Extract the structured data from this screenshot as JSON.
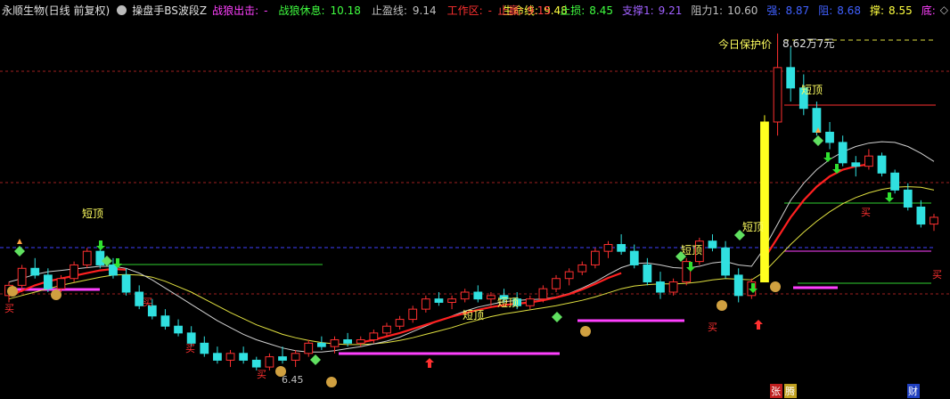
{
  "header": {
    "stock_name": "永顺生物(日线 前复权)",
    "indicator_name": "操盘手BS波段Z",
    "items": [
      {
        "label": "战狼出击:",
        "value": "-",
        "color": "#ff40ff"
      },
      {
        "label": "战狼休息:",
        "value": "10.18",
        "color": "#40ff40"
      },
      {
        "label": "止盈线:",
        "value": "9.14",
        "color": "#c0c0c0"
      },
      {
        "label": "工作区:",
        "value": "-",
        "color": "#ff3030"
      },
      {
        "label": "生命线:",
        "value": "9.48",
        "color": "#ffff40"
      }
    ],
    "right_items": [
      {
        "label": "止赢:",
        "value": "9.15",
        "color": "#ff4040"
      },
      {
        "label": "止损:",
        "value": "8.45",
        "color": "#40ff40"
      },
      {
        "label": "支撑1:",
        "value": "9.21",
        "color": "#a060ff"
      },
      {
        "label": "阻力1:",
        "value": "10.60",
        "color": "#c0c0c0"
      },
      {
        "label": "强:",
        "value": "8.87",
        "color": "#4060ff"
      },
      {
        "label": "阻:",
        "value": "8.68",
        "color": "#4060ff"
      },
      {
        "label": "撑:",
        "value": "8.55",
        "color": "#ffff40"
      },
      {
        "label": "底:",
        "value": "",
        "color": "#ff40ff"
      },
      {
        "label": "◇",
        "value": "",
        "color": "#c0c0c0"
      }
    ]
  },
  "annotations": {
    "protect_price_label": "今日保护价",
    "protect_price_value": "8.62万7元",
    "short_top": "短顶",
    "low_price": "6.45",
    "buy": "买",
    "zhang": "张",
    "teng": "腾",
    "cai": "财"
  },
  "colors": {
    "up": "#ff3030",
    "down": "#30e0e0",
    "ma_white": "#d0d0d0",
    "ma_red": "#ff2020",
    "ma_yellow": "#e0e040",
    "magenta": "#ff40ff"
  },
  "chart_data": {
    "type": "candlestick",
    "price_range": [
      6.2,
      11.5
    ],
    "candles": [
      [
        7.55,
        7.75,
        7.45,
        7.7
      ],
      [
        7.7,
        8.0,
        7.6,
        7.95
      ],
      [
        7.95,
        8.1,
        7.8,
        7.85
      ],
      [
        7.85,
        7.95,
        7.6,
        7.65
      ],
      [
        7.65,
        7.85,
        7.6,
        7.8
      ],
      [
        7.8,
        8.05,
        7.75,
        8.0
      ],
      [
        8.0,
        8.25,
        7.95,
        8.2
      ],
      [
        8.2,
        8.35,
        7.95,
        8.0
      ],
      [
        8.0,
        8.1,
        7.8,
        7.85
      ],
      [
        7.85,
        7.95,
        7.55,
        7.6
      ],
      [
        7.6,
        7.7,
        7.35,
        7.4
      ],
      [
        7.4,
        7.5,
        7.2,
        7.25
      ],
      [
        7.25,
        7.35,
        7.05,
        7.1
      ],
      [
        7.1,
        7.2,
        6.95,
        7.0
      ],
      [
        7.0,
        7.1,
        6.8,
        6.85
      ],
      [
        6.85,
        6.95,
        6.65,
        6.7
      ],
      [
        6.7,
        6.8,
        6.55,
        6.6
      ],
      [
        6.6,
        6.75,
        6.5,
        6.7
      ],
      [
        6.7,
        6.8,
        6.55,
        6.6
      ],
      [
        6.6,
        6.65,
        6.45,
        6.5
      ],
      [
        6.5,
        6.7,
        6.45,
        6.65
      ],
      [
        6.65,
        6.8,
        6.55,
        6.6
      ],
      [
        6.6,
        6.75,
        6.5,
        6.7
      ],
      [
        6.7,
        6.9,
        6.65,
        6.85
      ],
      [
        6.85,
        6.95,
        6.75,
        6.8
      ],
      [
        6.8,
        6.95,
        6.7,
        6.9
      ],
      [
        6.9,
        7.0,
        6.8,
        6.85
      ],
      [
        6.85,
        6.95,
        6.8,
        6.9
      ],
      [
        6.9,
        7.05,
        6.85,
        7.0
      ],
      [
        7.0,
        7.15,
        6.95,
        7.1
      ],
      [
        7.1,
        7.25,
        7.05,
        7.2
      ],
      [
        7.2,
        7.4,
        7.15,
        7.35
      ],
      [
        7.35,
        7.55,
        7.3,
        7.5
      ],
      [
        7.5,
        7.6,
        7.4,
        7.45
      ],
      [
        7.45,
        7.55,
        7.35,
        7.5
      ],
      [
        7.5,
        7.65,
        7.45,
        7.6
      ],
      [
        7.6,
        7.7,
        7.45,
        7.5
      ],
      [
        7.5,
        7.6,
        7.4,
        7.55
      ],
      [
        7.55,
        7.65,
        7.45,
        7.5
      ],
      [
        7.5,
        7.6,
        7.35,
        7.4
      ],
      [
        7.4,
        7.55,
        7.35,
        7.5
      ],
      [
        7.5,
        7.7,
        7.45,
        7.65
      ],
      [
        7.65,
        7.85,
        7.6,
        7.8
      ],
      [
        7.8,
        7.95,
        7.7,
        7.9
      ],
      [
        7.9,
        8.05,
        7.85,
        8.0
      ],
      [
        8.0,
        8.25,
        7.95,
        8.2
      ],
      [
        8.2,
        8.35,
        8.1,
        8.3
      ],
      [
        8.3,
        8.45,
        8.15,
        8.2
      ],
      [
        8.2,
        8.3,
        7.95,
        8.0
      ],
      [
        8.0,
        8.1,
        7.7,
        7.75
      ],
      [
        7.75,
        7.9,
        7.5,
        7.6
      ],
      [
        7.6,
        7.8,
        7.55,
        7.75
      ],
      [
        7.75,
        8.1,
        7.7,
        8.05
      ],
      [
        8.05,
        8.4,
        8.0,
        8.35
      ],
      [
        8.35,
        8.45,
        8.2,
        8.25
      ],
      [
        8.25,
        8.35,
        7.8,
        7.85
      ],
      [
        7.85,
        7.95,
        7.45,
        7.55
      ],
      [
        7.55,
        7.8,
        7.5,
        7.75
      ],
      [
        7.75,
        10.2,
        7.75,
        10.1
      ],
      [
        10.1,
        11.4,
        9.9,
        10.9
      ],
      [
        10.9,
        11.2,
        10.4,
        10.6
      ],
      [
        10.6,
        10.8,
        10.2,
        10.3
      ],
      [
        10.3,
        10.4,
        9.9,
        9.95
      ],
      [
        9.95,
        10.1,
        9.7,
        9.8
      ],
      [
        9.8,
        9.9,
        9.45,
        9.5
      ],
      [
        9.5,
        9.6,
        9.3,
        9.45
      ],
      [
        9.45,
        9.7,
        9.4,
        9.6
      ],
      [
        9.6,
        9.65,
        9.3,
        9.35
      ],
      [
        9.35,
        9.4,
        9.05,
        9.1
      ],
      [
        9.1,
        9.2,
        8.8,
        8.85
      ],
      [
        8.85,
        8.95,
        8.55,
        8.6
      ],
      [
        8.6,
        8.75,
        8.5,
        8.7
      ]
    ],
    "ma_white": [
      7.75,
      7.8,
      7.86,
      7.9,
      7.92,
      7.94,
      7.96,
      7.98,
      7.98,
      7.95,
      7.88,
      7.78,
      7.66,
      7.54,
      7.42,
      7.3,
      7.18,
      7.08,
      6.98,
      6.9,
      6.84,
      6.78,
      6.74,
      6.72,
      6.72,
      6.74,
      6.77,
      6.8,
      6.84,
      6.88,
      6.94,
      7.02,
      7.1,
      7.18,
      7.25,
      7.32,
      7.38,
      7.42,
      7.46,
      7.48,
      7.49,
      7.5,
      7.53,
      7.58,
      7.66,
      7.75,
      7.86,
      7.96,
      8.02,
      8.03,
      8.0,
      7.96,
      7.95,
      7.98,
      8.03,
      8.05,
      8.0,
      7.98,
      8.25,
      8.6,
      8.95,
      9.2,
      9.4,
      9.55,
      9.66,
      9.74,
      9.79,
      9.81,
      9.8,
      9.74,
      9.64,
      9.52
    ],
    "ma_red": [
      7.55,
      7.62,
      7.7,
      7.76,
      7.8,
      7.84,
      7.88,
      7.92,
      7.94,
      7.93,
      null,
      null,
      null,
      null,
      null,
      null,
      null,
      null,
      null,
      null,
      null,
      null,
      null,
      null,
      null,
      null,
      null,
      6.86,
      6.9,
      6.95,
      7.0,
      7.06,
      7.12,
      7.18,
      7.24,
      7.29,
      7.34,
      7.38,
      7.41,
      7.43,
      7.45,
      7.48,
      7.52,
      7.57,
      7.64,
      7.72,
      7.81,
      7.88,
      null,
      null,
      null,
      null,
      null,
      null,
      null,
      null,
      null,
      null,
      8.1,
      8.4,
      8.7,
      8.95,
      9.15,
      9.3,
      9.4,
      9.45,
      9.48,
      null,
      null,
      null,
      null,
      null
    ],
    "ma_yellow": [
      7.5,
      7.55,
      7.6,
      7.65,
      7.7,
      7.74,
      7.78,
      7.82,
      7.85,
      7.86,
      7.85,
      7.82,
      7.76,
      7.68,
      7.6,
      7.5,
      7.4,
      7.3,
      7.21,
      7.12,
      7.05,
      6.98,
      6.93,
      6.89,
      6.86,
      6.84,
      6.83,
      6.83,
      6.84,
      6.86,
      6.89,
      6.93,
      6.98,
      7.03,
      7.08,
      7.14,
      7.19,
      7.24,
      7.28,
      7.31,
      7.34,
      7.37,
      7.4,
      7.44,
      7.48,
      7.53,
      7.59,
      7.65,
      7.69,
      7.71,
      7.72,
      7.72,
      7.73,
      7.75,
      7.78,
      7.8,
      7.79,
      7.78,
      7.9,
      8.1,
      8.3,
      8.48,
      8.64,
      8.78,
      8.9,
      8.99,
      9.06,
      9.11,
      9.14,
      9.15,
      9.14,
      9.1
    ]
  }
}
